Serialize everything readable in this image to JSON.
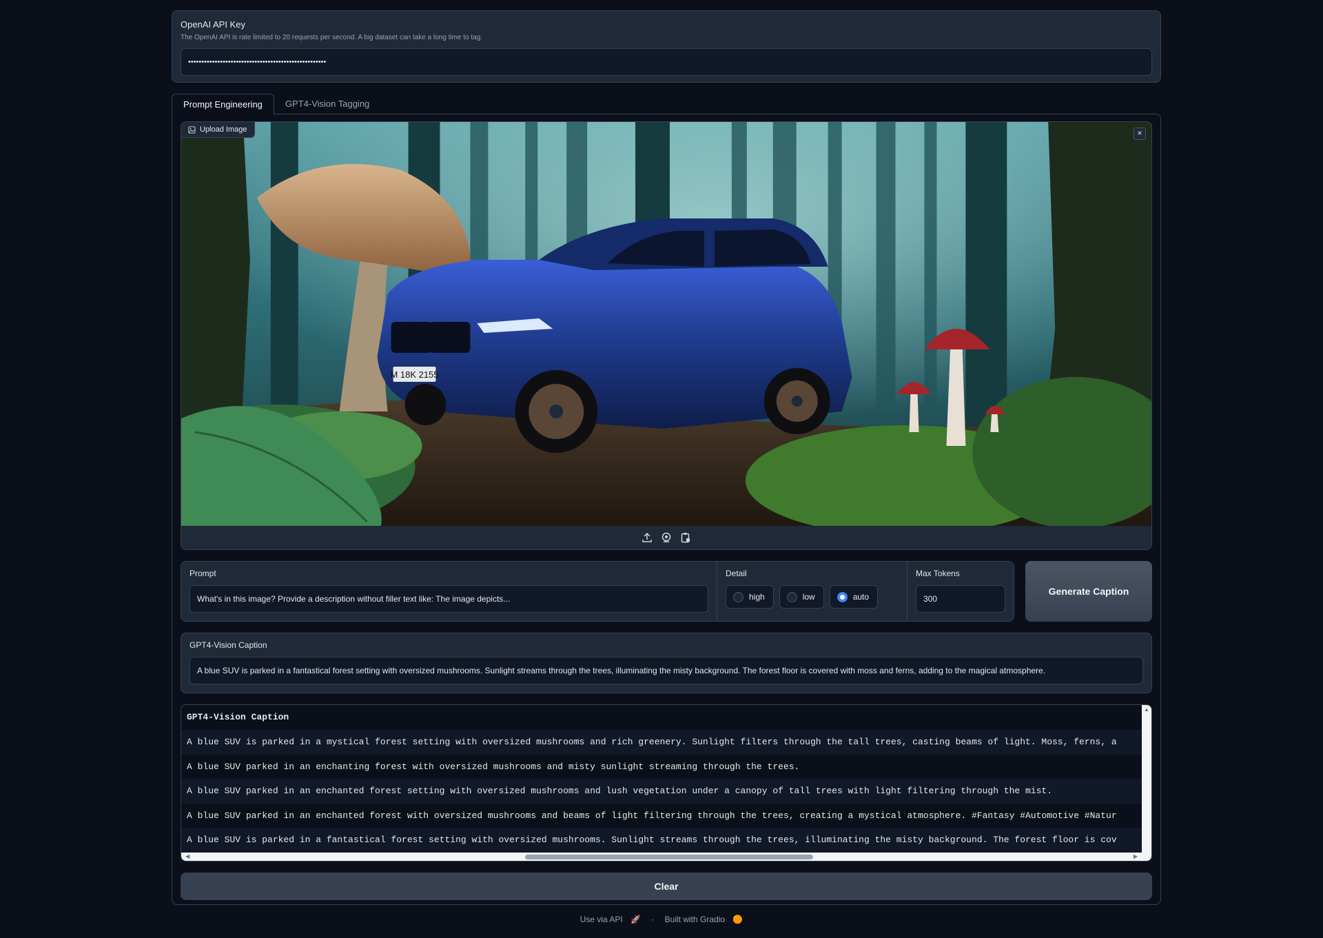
{
  "api_key": {
    "label": "OpenAI API Key",
    "info": "The OpenAI API is rate limited to 20 requests per second. A big dataset can take a long time to tag.",
    "value": "••••••••••••••••••••••••••••••••••••••••••••••••••••"
  },
  "tabs": [
    {
      "label": "Prompt Engineering",
      "active": true
    },
    {
      "label": "GPT4-Vision Tagging",
      "active": false
    }
  ],
  "image": {
    "badge": "Upload Image",
    "close": "×",
    "plate": "M 18K 2155",
    "toolbar_icons": [
      "upload-icon",
      "webcam-icon",
      "clipboard-icon"
    ]
  },
  "prompt": {
    "label": "Prompt",
    "value": "What's in this image? Provide a description without filler text like: The image depicts..."
  },
  "detail": {
    "label": "Detail",
    "options": [
      "high",
      "low",
      "auto"
    ],
    "selected": "auto"
  },
  "max_tokens": {
    "label": "Max Tokens",
    "value": "300"
  },
  "generate_button": "Generate Caption",
  "caption": {
    "label": "GPT4-Vision Caption",
    "value": "A blue SUV is parked in a fantastical forest setting with oversized mushrooms. Sunlight streams through the trees, illuminating the misty background. The forest floor is covered with moss and ferns, adding to the magical atmosphere."
  },
  "dataframe": {
    "header": "GPT4-Vision Caption",
    "rows": [
      "A blue SUV is parked in a mystical forest setting with oversized mushrooms and rich greenery. Sunlight filters through the tall trees, casting beams of light. Moss, ferns, a",
      "A blue SUV parked in an enchanting forest with oversized mushrooms and misty sunlight streaming through the trees.",
      "A blue SUV parked in an enchanted forest setting with oversized mushrooms and lush vegetation under a canopy of tall trees with light filtering through the mist.",
      "A blue SUV parked in an enchanted forest with oversized mushrooms and beams of light filtering through the trees, creating a mystical atmosphere. #Fantasy #Automotive #Natur",
      "A blue SUV is parked in a fantastical forest setting with oversized mushrooms. Sunlight streams through the trees, illuminating the misty background. The forest floor is cov"
    ]
  },
  "clear_button": "Clear",
  "footer": {
    "api": "Use via API",
    "sep": "·",
    "built": "Built with Gradio"
  },
  "colors": {
    "background": "#0b0f19",
    "panel": "#1f2937",
    "border": "#374151",
    "accent": "#3b82f6",
    "car": "#1e3a8a"
  }
}
